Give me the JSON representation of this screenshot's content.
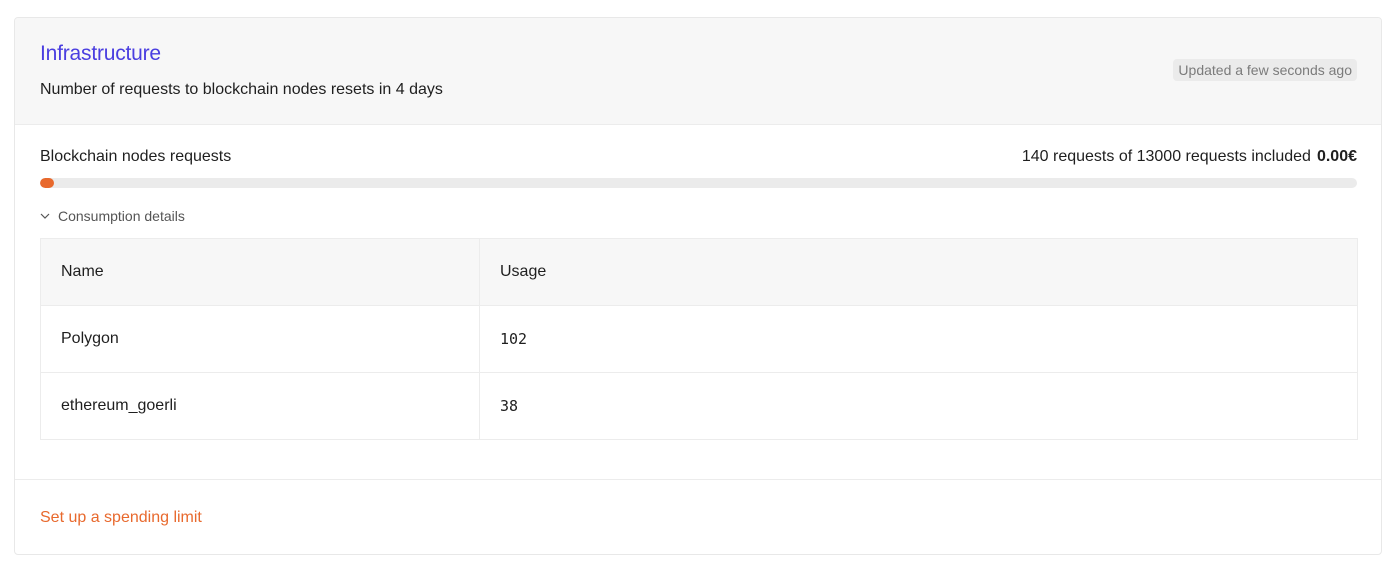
{
  "card": {
    "title": "Infrastructure",
    "subtitle": "Number of requests to blockchain nodes resets in 4 days",
    "updated": "Updated a few seconds ago"
  },
  "usage": {
    "label": "Blockchain nodes requests",
    "summary": "140 requests of 13000 requests included",
    "price": "0.00€",
    "used": 140,
    "included": 13000,
    "progress_fraction": 0.0108,
    "bar_color": "#e8692d"
  },
  "details": {
    "toggle_label": "Consumption details",
    "toggle_icon": "chevron-down-icon",
    "columns": [
      "Name",
      "Usage"
    ],
    "rows": [
      {
        "name": "Polygon",
        "usage": "102"
      },
      {
        "name": "ethereum_goerli",
        "usage": "38"
      }
    ]
  },
  "footer": {
    "link_label": "Set up a spending limit",
    "link_color": "#e8692d"
  },
  "colors": {
    "title": "#4a3ee0",
    "accent": "#e8692d"
  }
}
